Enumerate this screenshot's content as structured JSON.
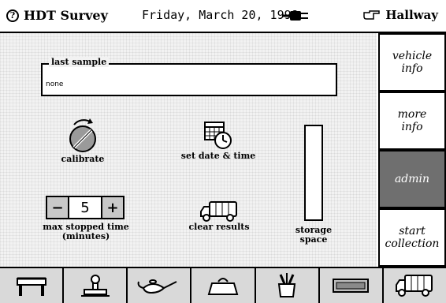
{
  "titlebar": {
    "app_icon": "question-circle-icon",
    "app_name": "HDT Survey",
    "date": "Friday, March 20, 1998",
    "power_icon": "power-plug-icon",
    "location_icon": "pointing-hand-icon",
    "location": "Hallway"
  },
  "last_sample": {
    "label": "last sample",
    "value": "none"
  },
  "tools": {
    "calibrate": "calibrate",
    "set_date_time": "set date & time",
    "clear_results": "clear results",
    "max_stopped_time_line1": "max stopped time",
    "max_stopped_time_line2": "(minutes)",
    "storage_line1": "storage",
    "storage_line2": "space"
  },
  "stepper": {
    "minus": "−",
    "value": "5",
    "plus": "+"
  },
  "storage": {
    "fill_fraction": 0
  },
  "sidebar": {
    "vehicle_info_1": "vehicle",
    "vehicle_info_2": "info",
    "more_info_1": "more",
    "more_info_2": "info",
    "admin": "admin",
    "start_collection_1": "start",
    "start_collection_2": "collection"
  },
  "dock": [
    "table-icon",
    "stamp-icon",
    "genie-lamp-icon",
    "purse-icon",
    "tools-cup-icon",
    "keyboard-icon",
    "truck-icon"
  ]
}
